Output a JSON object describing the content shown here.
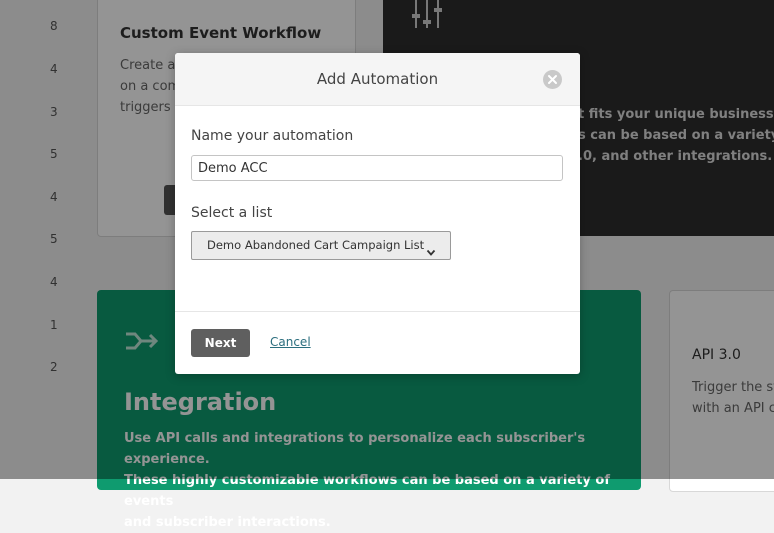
{
  "background": {
    "row_numbers": [
      "8",
      "4",
      "3",
      "5",
      "4",
      "5",
      "4",
      "1",
      "2"
    ],
    "custom_card": {
      "title": "Custom Event Workflow",
      "desc_lines": [
        "Create au",
        "on a com",
        "triggers a"
      ]
    },
    "dark_card": {
      "desc_lines": [
        "t fits your unique business nee",
        "s can be based on a variety of",
        ".0, and other integrations."
      ]
    },
    "integration_card": {
      "title": "Integration",
      "desc_lines": [
        "Use API calls and integrations to personalize each subscriber's experience.",
        "These highly customizable workflows can be based on a variety of events",
        "and subscriber interactions."
      ],
      "icon": "shuffle-arrow-icon"
    },
    "api_card": {
      "title": "API 3.0",
      "desc_lines": [
        "Trigger the st",
        "with an API ca"
      ]
    }
  },
  "modal": {
    "title": "Add Automation",
    "name_label": "Name your automation",
    "name_value": "Demo ACC",
    "list_label": "Select a list",
    "list_selected": "Demo Abandoned Cart Campaign List",
    "next_label": "Next",
    "cancel_label": "Cancel"
  },
  "colors": {
    "overlay": "#000000",
    "green_card": "#0f9b6f",
    "next_button": "#5f5f5f",
    "cancel_link": "#2b6e7e"
  }
}
